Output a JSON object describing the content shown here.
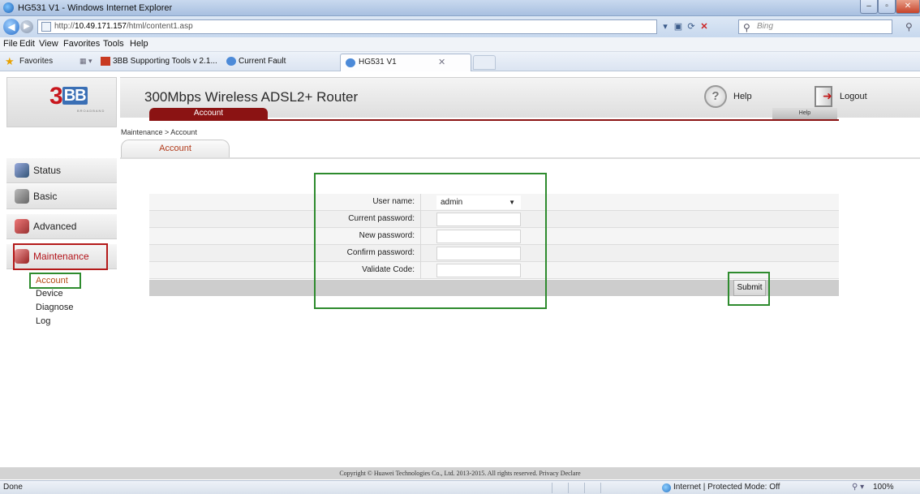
{
  "window": {
    "title": "HG531 V1 - Windows Internet Explorer"
  },
  "browser": {
    "url_prefix": "http://",
    "url_host": "10.49.171.157",
    "url_path": "/html/content1.asp",
    "search_placeholder": "Bing",
    "menu": [
      "File",
      "Edit",
      "View",
      "Favorites",
      "Tools",
      "Help"
    ],
    "favorites_label": "Favorites",
    "fav_links": [
      "3BB Supporting Tools v 2.1...",
      "Current Fault"
    ],
    "tab_title": "HG531 V1",
    "status_text": "Done",
    "zone_text": "Internet | Protected Mode: Off",
    "zoom": "100%"
  },
  "header": {
    "logo_text": "3",
    "logo_bb": "BB",
    "logo_sub": "BROADBAND",
    "product": "300Mbps Wireless ADSL2+ Router",
    "help_label": "Help",
    "logout_label": "Logout"
  },
  "breadcrumb": "Maintenance > Account",
  "subtab": "Account",
  "sidebar": {
    "items": [
      {
        "label": "Status"
      },
      {
        "label": "Basic"
      },
      {
        "label": "Advanced"
      },
      {
        "label": "Maintenance"
      }
    ],
    "subitems": [
      "Account",
      "Device",
      "Diagnose",
      "Log"
    ]
  },
  "panel": {
    "tab_label": "Account",
    "help_label": "Help",
    "fields": [
      {
        "label": "User name:",
        "value": "admin"
      },
      {
        "label": "Current password:",
        "value": ""
      },
      {
        "label": "New password:",
        "value": ""
      },
      {
        "label": "Confirm password:",
        "value": ""
      },
      {
        "label": "Validate Code:",
        "value": ""
      }
    ],
    "submit_label": "Submit"
  },
  "copyright": "Copyright © Huawei Technologies Co., Ltd. 2013-2015. All rights reserved. Privacy Declare",
  "colors": {
    "accent_red": "#8b1313",
    "highlight_green": "#2e8b2e",
    "highlight_red": "#b41a1a"
  }
}
